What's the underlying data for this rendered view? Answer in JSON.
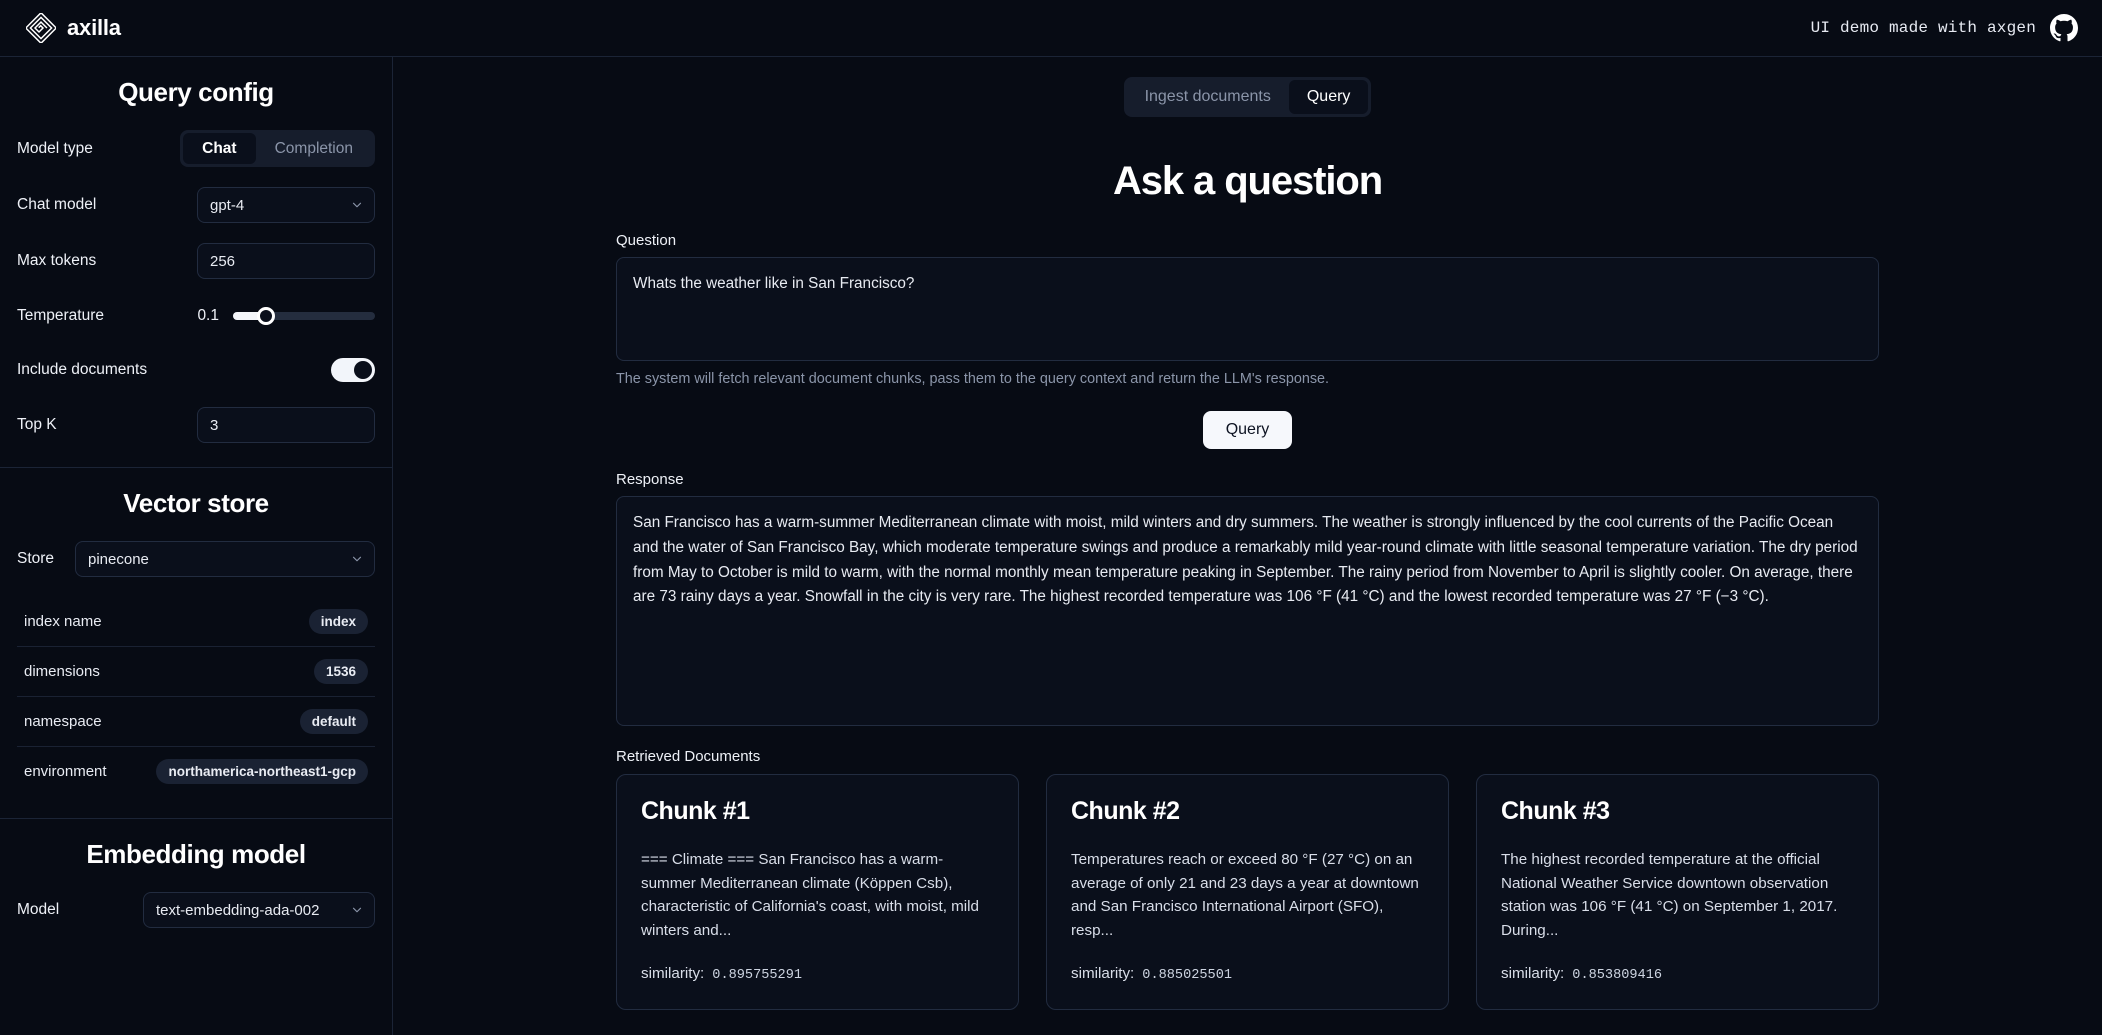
{
  "header": {
    "brand": "axilla",
    "logo_icon": "axilla-diamond-logo",
    "note": "UI demo made with axgen",
    "github_icon": "github-icon",
    "accent": "#f6f8fc",
    "background": "#070b14",
    "surface": "#0a0f1b",
    "border": "#222c40"
  },
  "sidebar": {
    "query_config": {
      "title": "Query config",
      "model_type": {
        "label": "Model type",
        "options": [
          "Chat",
          "Completion"
        ],
        "selected": "Chat"
      },
      "chat_model": {
        "label": "Chat model",
        "value": "gpt-4",
        "chevron_icon": "chevron-down-icon"
      },
      "max_tokens": {
        "label": "Max tokens",
        "value": "256"
      },
      "temperature": {
        "label": "Temperature",
        "value": "0.1",
        "min": 0,
        "max": 1
      },
      "include_documents": {
        "label": "Include documents",
        "enabled": true
      },
      "top_k": {
        "label": "Top K",
        "value": "3"
      }
    },
    "vector_store": {
      "title": "Vector store",
      "store": {
        "label": "Store",
        "value": "pinecone"
      },
      "properties": [
        {
          "key": "index name",
          "value": "index"
        },
        {
          "key": "dimensions",
          "value": "1536"
        },
        {
          "key": "namespace",
          "value": "default"
        },
        {
          "key": "environment",
          "value": "northamerica-northeast1-gcp"
        }
      ]
    },
    "embedding_model": {
      "title": "Embedding model",
      "model": {
        "label": "Model",
        "value": "text-embedding-ada-002"
      }
    }
  },
  "main": {
    "tabs": [
      {
        "label": "Ingest documents",
        "active": false
      },
      {
        "label": "Query",
        "active": true
      }
    ],
    "page_title": "Ask a question",
    "question": {
      "label": "Question",
      "value": "Whats the weather like in San Francisco?",
      "placeholder": "Whats the weather like in San Francisco?",
      "helper": "The system will fetch relevant document chunks, pass them to the query context and return the LLM's response."
    },
    "query_button": "Query",
    "response": {
      "label": "Response",
      "value": "San Francisco has a warm-summer Mediterranean climate with moist, mild winters and dry summers. The weather is strongly influenced by the cool currents of the Pacific Ocean and the water of San Francisco Bay, which moderate temperature swings and produce a remarkably mild year-round climate with little seasonal temperature variation. The dry period from May to October is mild to warm, with the normal monthly mean temperature peaking in September. The rainy period from November to April is slightly cooler. On average, there are 73 rainy days a year. Snowfall in the city is very rare. The highest recorded temperature was 106 °F (41 °C) and the lowest recorded temperature was 27 °F (−3 °C)."
    },
    "retrieved_documents": {
      "label": "Retrieved Documents",
      "similarity_label": "similarity:",
      "chunks": [
        {
          "title": "Chunk #1",
          "text": "=== Climate === San Francisco has a warm-summer Mediterranean climate (Köppen Csb), characteristic of California's coast, with moist, mild winters and...",
          "similarity": "0.895755291"
        },
        {
          "title": "Chunk #2",
          "text": "Temperatures reach or exceed 80 °F (27 °C) on an average of only 21 and 23 days a year at downtown and San Francisco International Airport (SFO), resp...",
          "similarity": "0.885025501"
        },
        {
          "title": "Chunk #3",
          "text": "The highest recorded temperature at the official National Weather Service downtown observation station was 106 °F (41 °C) on September 1, 2017. During...",
          "similarity": "0.853809416"
        }
      ]
    }
  }
}
